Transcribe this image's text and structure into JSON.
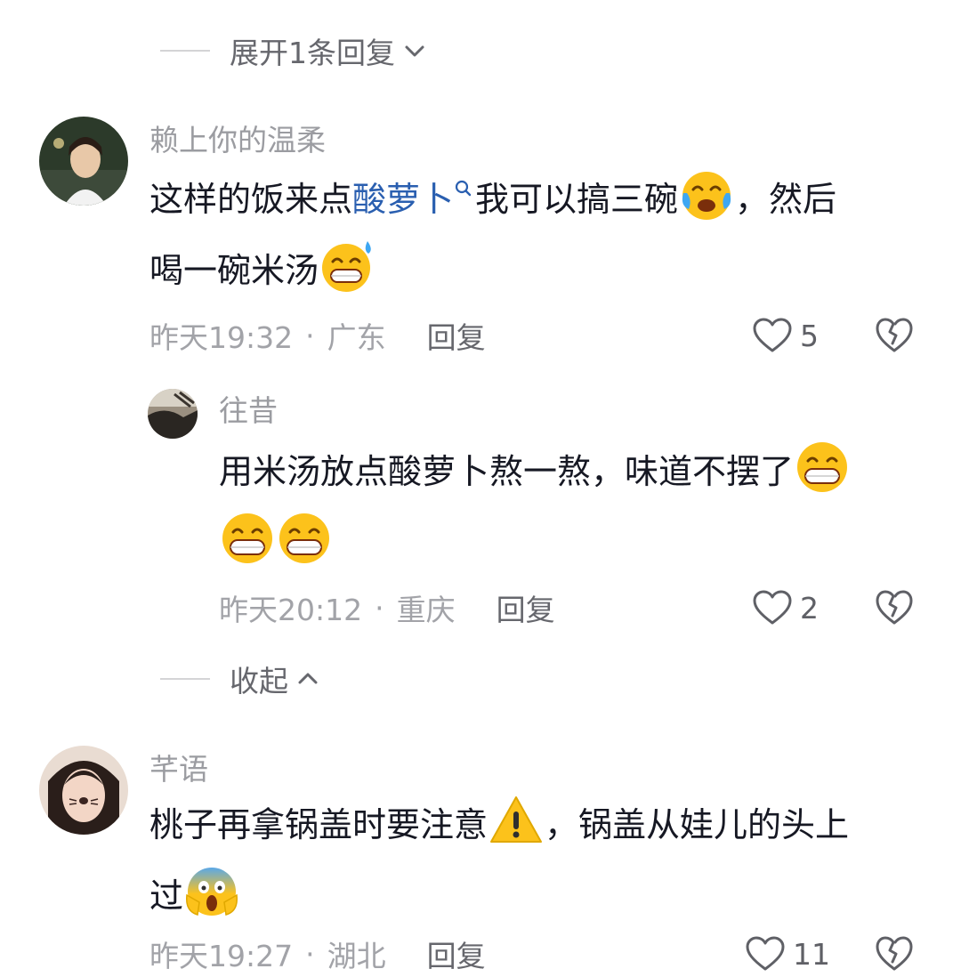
{
  "expand_replies": {
    "label": "展开1条回复"
  },
  "collapse_replies": {
    "label": "收起"
  },
  "comments": [
    {
      "username": "赖上你的温柔",
      "text_part1": "这样的饭来点",
      "keyword": "酸萝卜",
      "text_part2": "我可以搞三碗",
      "text_part3": "，然后",
      "text_line2": "喝一碗米汤",
      "time": "昨天19:32",
      "location": "广东",
      "reply_label": "回复",
      "likes": "5"
    },
    {
      "username": "往昔",
      "text_part1": "用米汤放点酸萝卜熬一熬，味道不摆了",
      "time": "昨天20:12",
      "location": "重庆",
      "reply_label": "回复",
      "likes": "2"
    },
    {
      "username": "芊语",
      "text_part1": "桃子再拿锅盖时要注意",
      "text_part2": "，锅盖从娃儿的头上",
      "text_line2": "过",
      "time": "昨天19:27",
      "location": "湖北",
      "reply_label": "回复",
      "likes": "11"
    }
  ],
  "separator": "·",
  "icons": [
    "chevron-down-icon",
    "chevron-up-icon",
    "search-icon",
    "heart-icon",
    "broken-heart-icon",
    "crying-laugh-emoji",
    "sweat-grin-emoji",
    "grin-emoji",
    "warning-emoji",
    "scream-emoji"
  ],
  "colors": {
    "keyword": "#2a5fb0",
    "muted": "#a2a3a8",
    "text": "#161823"
  }
}
